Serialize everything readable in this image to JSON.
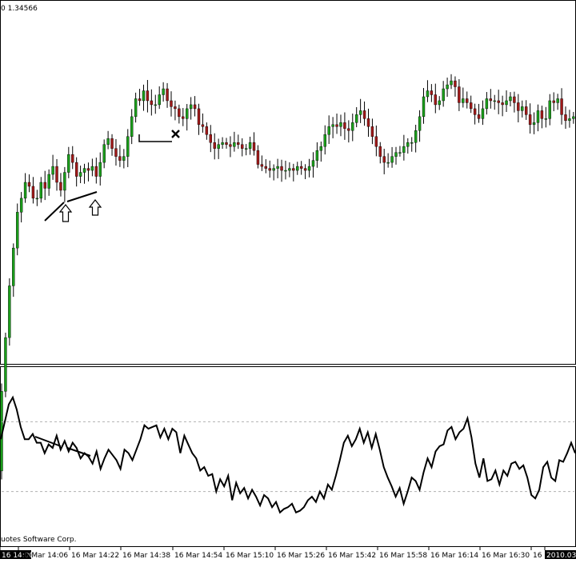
{
  "header": {
    "price_label": "0 1.34566"
  },
  "footer": {
    "copyright": "uotes Software Corp."
  },
  "colors": {
    "up": "#1a9e1a",
    "down": "#a01818",
    "wick": "#000000",
    "osc": "#000000",
    "level_line": "#b0b0b0"
  },
  "chart_data": [
    {
      "type": "candlestick",
      "title": "",
      "xlabel": "",
      "ylabel": "",
      "x_ticks": [
        "16 14:00",
        "16 Mar 14:06",
        "16 Mar 14:22",
        "16 Mar 14:38",
        "16 Mar 14:54",
        "16 Mar 15:10",
        "16 Mar 15:26",
        "16 Mar 15:42",
        "16 Mar 15:58",
        "16 Mar 16:14",
        "16 Mar 16:30",
        "16 M",
        "2010.03"
      ],
      "ylim": [
        1.3447,
        1.3465
      ],
      "close": [
        1.34455,
        1.34482,
        1.34508,
        1.34527,
        1.34545,
        1.34552,
        1.3456,
        1.34558,
        1.34552,
        1.34552,
        1.3456,
        1.34557,
        1.34564,
        1.34568,
        1.3456,
        1.34556,
        1.34565,
        1.34574,
        1.3457,
        1.34563,
        1.34565,
        1.34567,
        1.34566,
        1.34568,
        1.34563,
        1.3457,
        1.34579,
        1.34582,
        1.34577,
        1.34573,
        1.34571,
        1.34573,
        1.34583,
        1.34593,
        1.34602,
        1.34601,
        1.34606,
        1.34601,
        1.34599,
        1.34599,
        1.34604,
        1.34607,
        1.34601,
        1.34598,
        1.34597,
        1.34593,
        1.34592,
        1.34597,
        1.34599,
        1.34597,
        1.34589,
        1.34588,
        1.34584,
        1.3458,
        1.34577,
        1.34579,
        1.3458,
        1.34579,
        1.34578,
        1.3458,
        1.34579,
        1.34577,
        1.34577,
        1.3458,
        1.34576,
        1.34569,
        1.34568,
        1.34567,
        1.34566,
        1.34567,
        1.34568,
        1.34566,
        1.34566,
        1.34567,
        1.34566,
        1.34568,
        1.34567,
        1.34566,
        1.34568,
        1.34571,
        1.34576,
        1.34578,
        1.34584,
        1.34588,
        1.34589,
        1.34588,
        1.3459,
        1.34587,
        1.34586,
        1.3459,
        1.34594,
        1.34596,
        1.34592,
        1.34588,
        1.34583,
        1.34578,
        1.34573,
        1.3457,
        1.3457,
        1.34573,
        1.34575,
        1.34575,
        1.34578,
        1.3458,
        1.3458,
        1.34586,
        1.34593,
        1.34603,
        1.34606,
        1.34604,
        1.34599,
        1.34601,
        1.34607,
        1.34609,
        1.34611,
        1.34608,
        1.346,
        1.34602,
        1.346,
        1.34597,
        1.34594,
        1.34592,
        1.34597,
        1.34602,
        1.34601,
        1.34601,
        1.346,
        1.34599,
        1.34601,
        1.34603,
        1.346,
        1.34596,
        1.34598,
        1.34594,
        1.34589,
        1.3459,
        1.34596,
        1.34592,
        1.34592,
        1.34601,
        1.346,
        1.34602,
        1.34594,
        1.34591,
        1.34592,
        1.34593,
        1.34592
      ]
    },
    {
      "type": "line",
      "title": "",
      "xlabel": "",
      "ylabel": "",
      "ylim": [
        0,
        100
      ],
      "levels": [
        70,
        30
      ],
      "values": [
        60,
        70,
        80,
        84,
        77,
        67,
        60,
        60,
        63,
        58,
        58,
        52,
        57,
        55,
        62,
        54,
        59,
        53,
        58,
        55,
        49,
        52,
        50,
        46,
        53,
        43,
        49,
        54,
        51,
        48,
        43,
        54,
        52,
        48,
        54,
        60,
        68,
        66,
        67,
        68,
        61,
        66,
        60,
        66,
        64,
        52,
        62,
        57,
        52,
        49,
        42,
        44,
        39,
        40,
        30,
        37,
        33,
        39,
        25,
        35,
        29,
        32,
        26,
        31,
        27,
        22,
        28,
        26,
        21,
        24,
        18,
        20,
        21,
        23,
        18,
        19,
        21,
        25,
        27,
        24,
        30,
        26,
        34,
        31,
        39,
        48,
        58,
        62,
        56,
        60,
        66,
        58,
        64,
        55,
        63,
        54,
        44,
        38,
        33,
        27,
        32,
        23,
        30,
        38,
        36,
        31,
        41,
        49,
        44,
        53,
        56,
        57,
        65,
        67,
        60,
        64,
        66,
        72,
        61,
        46,
        38,
        49,
        36,
        37,
        42,
        34,
        42,
        39,
        46,
        47,
        43,
        45,
        38,
        28,
        26,
        31,
        44,
        47,
        38,
        36,
        48,
        47,
        52,
        58,
        52
      ]
    }
  ]
}
